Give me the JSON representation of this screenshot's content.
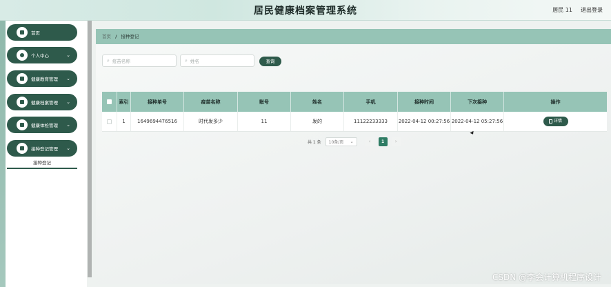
{
  "header": {
    "title": "居民健康档案管理系统",
    "user": "居民 11",
    "logout": "退出登录"
  },
  "sidebar": {
    "items": [
      {
        "label": "首页",
        "icon": "home-icon",
        "expandable": false
      },
      {
        "label": "个人中心",
        "icon": "user-icon",
        "expandable": true
      },
      {
        "label": "健康教育管理",
        "icon": "book-icon",
        "expandable": true
      },
      {
        "label": "健康档案管理",
        "icon": "folder-icon",
        "expandable": true
      },
      {
        "label": "健康体检管理",
        "icon": "clipboard-icon",
        "expandable": true
      },
      {
        "label": "接种登记管理",
        "icon": "syringe-icon",
        "expandable": true
      }
    ],
    "submenu_active": "接种登记"
  },
  "breadcrumb": {
    "home": "首页",
    "separator": "/",
    "current": "接种登记"
  },
  "search": {
    "vaccine_placeholder": "疫苗名称",
    "name_placeholder": "姓名",
    "button": "查询"
  },
  "table": {
    "headers": [
      "索引",
      "接种单号",
      "疫苗名称",
      "账号",
      "姓名",
      "手机",
      "接种时间",
      "下次接种",
      "操作"
    ],
    "rows": [
      {
        "index": "1",
        "order_no": "1649694476516",
        "vaccine": "时代发多少",
        "account": "11",
        "name": "发的",
        "phone": "11122233333",
        "time": "2022-04-12 00:27:56",
        "next": "2022-04-12 05:27:56",
        "action": "详情"
      }
    ]
  },
  "pagination": {
    "total": "共 1 条",
    "page_size": "10条/页",
    "current_page": "1",
    "prev": "‹",
    "next": "›"
  },
  "watermark": "CSDN @李会计算机程序设计",
  "colors": {
    "primary": "#2e5a4b",
    "header_bar": "#96c4b6",
    "active_page": "#2e7c64"
  }
}
